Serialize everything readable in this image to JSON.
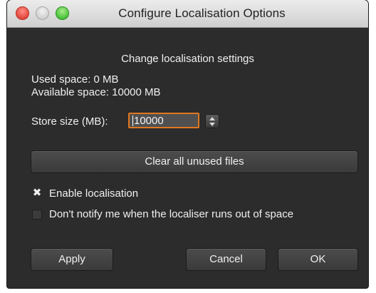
{
  "window": {
    "title": "Configure Localisation Options"
  },
  "settings": {
    "heading": "Change localisation settings",
    "used_space": "Used space: 0 MB",
    "available_space": "Available space: 10000 MB",
    "store_size_label": "Store size (MB):",
    "store_size_value": "10000"
  },
  "actions": {
    "clear_label": "Clear all unused files"
  },
  "options": {
    "enable_label": "Enable localisation",
    "enable_checked": true,
    "notify_label": "Don't notify me when the localiser runs out of space",
    "notify_checked": false
  },
  "footer": {
    "apply_label": "Apply",
    "cancel_label": "Cancel",
    "ok_label": "OK"
  },
  "colors": {
    "window_bg": "#2c2c2c",
    "focus_ring": "#e0771f",
    "close": "#e2463b",
    "minimize": "#cfcfcf",
    "maximize": "#48c13a"
  },
  "icons": {
    "checkmark": "x-check-icon",
    "stepper": "stepper-arrows-icon"
  }
}
